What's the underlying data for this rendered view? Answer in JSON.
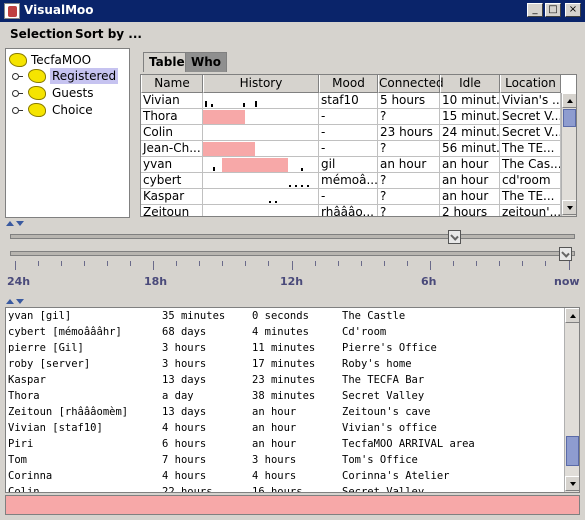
{
  "window": {
    "title": "VisualMoo"
  },
  "menu": [
    "Selection",
    "Sort by ..."
  ],
  "tree": {
    "root": "TecfaMOO",
    "children": [
      "Registered",
      "Guests",
      "Choice"
    ],
    "selected": "Registered"
  },
  "tabs": [
    "Table",
    "Who"
  ],
  "table": {
    "columns": [
      "Name",
      "History",
      "Mood",
      "Connected",
      "Idle",
      "Location"
    ],
    "rows": [
      {
        "name": "Vivian",
        "mood": "staf10",
        "connected": "5 hours",
        "idle": "10 minut...",
        "location": "Vivian's ..."
      },
      {
        "name": "Thora",
        "mood": "-",
        "connected": "?",
        "idle": "15 minut...",
        "location": "Secret V..."
      },
      {
        "name": "Colin",
        "mood": "-",
        "connected": "23 hours",
        "idle": "24 minut...",
        "location": "Secret V..."
      },
      {
        "name": "Jean-Ch...",
        "mood": "-",
        "connected": "?",
        "idle": "56 minut...",
        "location": "The TE..."
      },
      {
        "name": "yvan",
        "mood": "gil",
        "connected": "an hour",
        "idle": "an hour",
        "location": "The Cas..."
      },
      {
        "name": "cybert",
        "mood": "mémoâ...",
        "connected": "?",
        "idle": "an hour",
        "location": "cd'room"
      },
      {
        "name": "Kaspar",
        "mood": "-",
        "connected": "?",
        "idle": "an hour",
        "location": "The TE..."
      },
      {
        "name": "Zeitoun",
        "mood": "rhâââo...",
        "connected": "?",
        "idle": "2 hours",
        "location": "zeitoun'..."
      }
    ]
  },
  "timeline": {
    "labels": [
      "24h",
      "18h",
      "12h",
      "6h",
      "now"
    ],
    "upper_slider_fraction": 0.8,
    "lower_slider_fraction": 1.0
  },
  "log": [
    [
      "yvan [gil]",
      "35 minutes",
      "0 seconds",
      "The Castle"
    ],
    [
      "cybert [mémoâââhr]",
      "68 days",
      "4 minutes",
      "Cd'room"
    ],
    [
      "pierre [Gil]",
      "3 hours",
      "11 minutes",
      "Pierre's Office"
    ],
    [
      "roby [server]",
      "3 hours",
      "17 minutes",
      "Roby's home"
    ],
    [
      "Kaspar",
      "13 days",
      "23 minutes",
      "The TECFA Bar"
    ],
    [
      "Thora",
      "a day",
      "38 minutes",
      "Secret Valley"
    ],
    [
      "Zeitoun [rhâââomèm]",
      "13 days",
      "an hour",
      "Zeitoun's cave"
    ],
    [
      "Vivian [staf10]",
      "4 hours",
      "an hour",
      "Vivian's office"
    ],
    [
      "Piri",
      "6 hours",
      "an hour",
      "TecfaMOO ARRIVAL area"
    ],
    [
      "Tom",
      "7 hours",
      "3 hours",
      "Tom's Office"
    ],
    [
      "Corinna",
      "4 hours",
      "4 hours",
      "Corinna's Atelier"
    ],
    [
      "Colin",
      "22 hours",
      "16 hours",
      "Secret Valley"
    ]
  ],
  "colors": {
    "titlebar": "#0a246a",
    "history_bar": "#f7a8a8",
    "status_bar": "#f7a8a8",
    "tree_node": "#f5e400",
    "selection": "#c6c3f0"
  },
  "icons": [
    "app-icon",
    "minimize-icon",
    "maximize-icon",
    "close-icon",
    "folder-blob-icon",
    "tree-handle-icon",
    "scroll-up-icon",
    "scroll-down-icon",
    "slider-thumb-icon"
  ]
}
